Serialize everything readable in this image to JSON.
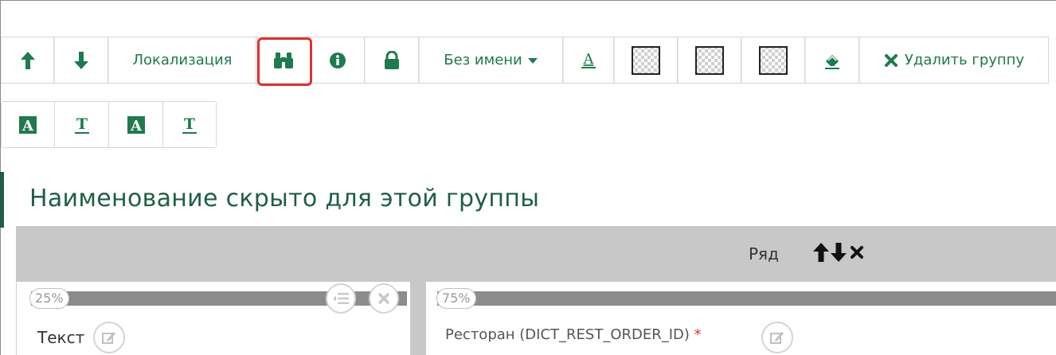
{
  "toolbar": {
    "localization_label": "Локализация",
    "name_label": "Без имени",
    "delete_group_label": "Удалить группу"
  },
  "group": {
    "title": "Наименование скрыто для этой группы"
  },
  "row": {
    "label": "Ряд"
  },
  "columns": [
    {
      "width_percent": "25%",
      "field_label": "Текст"
    },
    {
      "width_percent": "75%",
      "field_label": "Ресторан (DICT_REST_ORDER_ID)",
      "required_mark": "*"
    }
  ],
  "colors": {
    "accent": "#1f7a4d",
    "title": "#1f5e44",
    "highlight": "#e03131",
    "row_bg": "#c8c8c8"
  },
  "icons": [
    "arrow-up-icon",
    "arrow-down-icon",
    "binoculars-icon",
    "info-icon",
    "lock-icon",
    "caret-down-icon",
    "font-color-icon",
    "transparent-swatch-icon",
    "eraser-icon",
    "close-icon",
    "text-bg-icon",
    "text-underline-icon",
    "list-icon",
    "pencil-icon"
  ]
}
